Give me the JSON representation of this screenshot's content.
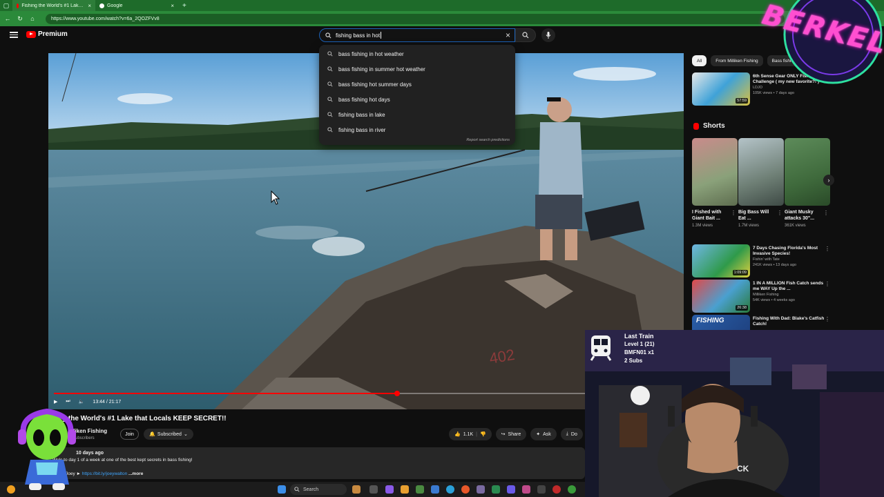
{
  "browser": {
    "tabs": [
      {
        "label": "Fishing the World's #1 Lake that Locals KEEP SECRET!! - YouTube",
        "active": true,
        "favicon": "youtube-icon"
      },
      {
        "label": "Google",
        "active": false,
        "favicon": "google-icon"
      }
    ],
    "url": "https://www.youtube.com/watch?v=6a_2QOZFVv8"
  },
  "header": {
    "logo_text": "Premium",
    "search_value": "fishing bass in hot"
  },
  "suggestions": {
    "items": [
      "bass fishing in hot weather",
      "bass fishing in summer hot weather",
      "bass fishing hot summer days",
      "bass fishing hot days",
      "fishing bass in lake",
      "fishing bass in river"
    ],
    "report": "Report search predictions"
  },
  "player": {
    "time": "13:44 / 21:17",
    "progress": 0.645
  },
  "video": {
    "title": "g the World's #1 Lake that Locals KEEP SECRET!!",
    "channel": "lliken Fishing",
    "subs": "subscribers",
    "join_label": "Join",
    "subscribed_label": "Subscribed",
    "likes": "1.1K",
    "share_label": "Share",
    "ask_label": "Ask",
    "download_label": "Do",
    "desc_meta": "10 days ago",
    "desc_line": "Welc    to day 1 of a week at one of the best kept secrets in bass fishing!",
    "desc_follow": "llow Joey ►",
    "desc_link": "https://bit.ly/joeywalton",
    "desc_more": "...more"
  },
  "sidebar": {
    "chips": [
      "All",
      "From Milliken Fishing",
      "Bass fishi..."
    ],
    "top_rec": {
      "title": "6th Sense Gear ONLY Fishing Challenge ( my new favorite?! )",
      "channel": "LDJO",
      "views": "105K views • 7 days ago",
      "duration": "57:59"
    },
    "shorts_heading": "Shorts",
    "shorts": [
      {
        "title": "I Fished with Giant Bait ...",
        "views": "1.3M views"
      },
      {
        "title": "Big Bass Will Eat ...",
        "views": "1.7M views"
      },
      {
        "title": "Giant Musky attacks 30\"...",
        "views": "361K views"
      }
    ],
    "recs": [
      {
        "title": "7 Days Chasing Florida's Most Invasive Species!",
        "channel": "Fishin' with Tate",
        "views": "241K views • 13 days ago",
        "duration": "1:09:09"
      },
      {
        "title": "1 IN A MILLION Fish Catch sends me WAY Up the ...",
        "channel": "Milliken Fishing",
        "views": "54K views • 4 weeks ago",
        "duration": "26:38"
      },
      {
        "title": "Fishing With Dad: Blake's Catfish Catch!",
        "channel": "",
        "views": "",
        "duration": ""
      }
    ]
  },
  "overlay": {
    "train_name": "Last Train",
    "train_level": "Level 1  (21)",
    "train_user": "BMFN01 x1",
    "train_subs": "2 Subs",
    "brand": "BERKEL"
  },
  "taskbar": {
    "search_label": "Search"
  },
  "colors": {
    "chrome_green": "#2b8a3a",
    "yt_red": "#ff0000",
    "accent_blue": "#3ea6ff"
  }
}
